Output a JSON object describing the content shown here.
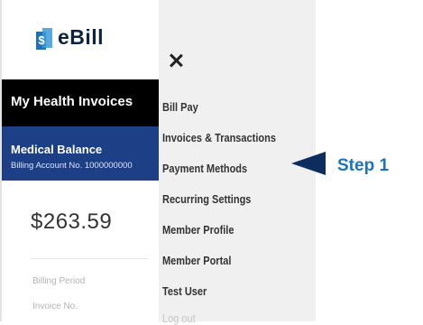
{
  "app": {
    "logo_text": "eBill",
    "logo_glyph": "$"
  },
  "header": {
    "title": "My Health Invoices"
  },
  "balance_card": {
    "title": "Medical Balance",
    "account": "Billing Account No. 1000000000"
  },
  "main": {
    "amount": "$263.59",
    "faint_line_1": "Billing Period",
    "faint_line_2": "Invoice No."
  },
  "menu": {
    "close_label": "×",
    "items": [
      {
        "label": "Bill Pay"
      },
      {
        "label": "Invoices & Transactions"
      },
      {
        "label": "Payment Methods"
      },
      {
        "label": "Recurring Settings"
      },
      {
        "label": "Member Profile"
      },
      {
        "label": "Member Portal"
      },
      {
        "label": "Test User"
      },
      {
        "label": "Log out"
      }
    ]
  },
  "callout": {
    "label": "Step 1",
    "color": "#1b72c0",
    "arrow_color": "#0d2d5e"
  }
}
